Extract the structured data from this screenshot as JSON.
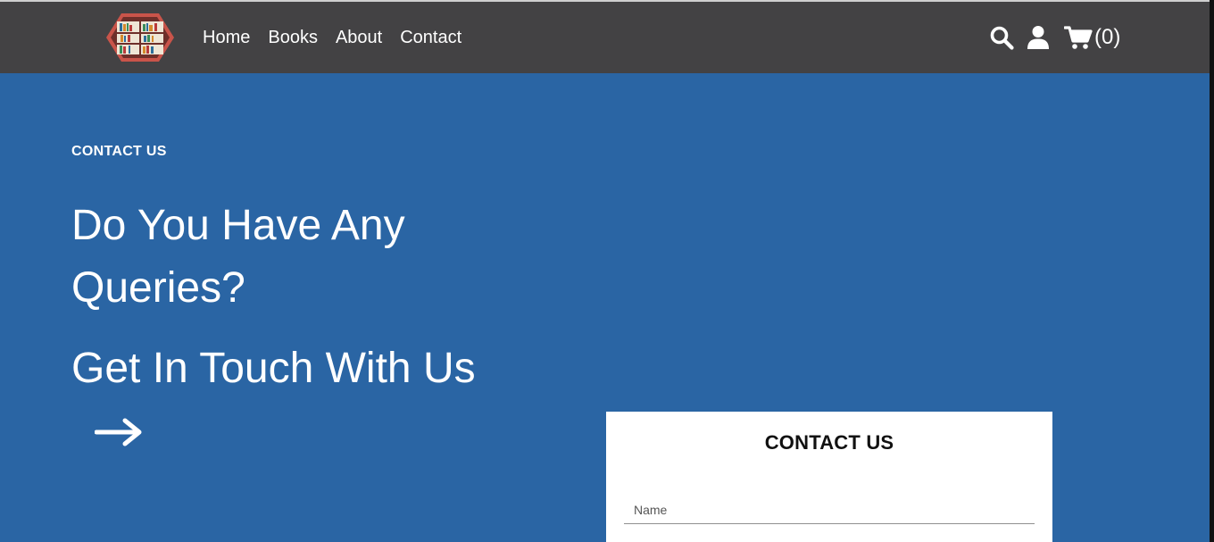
{
  "nav": {
    "links": [
      "Home",
      "Books",
      "About",
      "Contact"
    ],
    "cart_count": "(0)",
    "icons": {
      "logo": "bookshelf-hexagon-logo",
      "search": "search-icon",
      "user": "user-icon",
      "cart": "cart-icon"
    }
  },
  "hero": {
    "eyebrow": "CONTACT US",
    "heading_line1": "Do You Have Any Queries?",
    "heading_line2": "Get In Touch With Us",
    "arrow_icon": "arrow-right-icon"
  },
  "form": {
    "title": "CONTACT US",
    "name_placeholder": "Name"
  },
  "colors": {
    "navbar": "#434244",
    "hero_background": "#2a65a4",
    "card": "#ffffff",
    "logo_accent": "#c9544a"
  }
}
